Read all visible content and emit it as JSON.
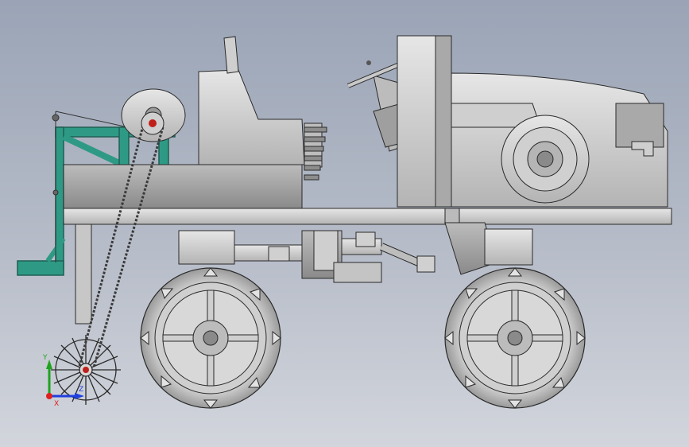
{
  "viewport": {
    "background_top": "#9aa4b6",
    "background_bottom": "#d2d5dc"
  },
  "colors": {
    "body_gray": "#d6d6d6",
    "body_dark": "#8e8e8e",
    "outline": "#2a2a2a",
    "teal_frame": "#2e9a86",
    "hub_red": "#c0201a",
    "chain": "#3a3a3a"
  },
  "axis_triad": {
    "x_label": "X",
    "y_label": "Y",
    "z_label": "Z",
    "x_color": "#e02020",
    "y_color": "#1fa31f",
    "z_color": "#1f3fe0"
  },
  "parts": [
    "main-chassis-frame",
    "engine-hood",
    "radiator-grille",
    "steering-wheel",
    "steering-column",
    "operator-seat",
    "fuel-tank",
    "rear-storage-box",
    "front-wheel",
    "rear-wheel",
    "drive-shaft",
    "universal-joint",
    "gearbox",
    "teal-attachment-frame",
    "spiked-ground-wheel",
    "chain-drive",
    "drive-sprocket",
    "cable-reel"
  ]
}
